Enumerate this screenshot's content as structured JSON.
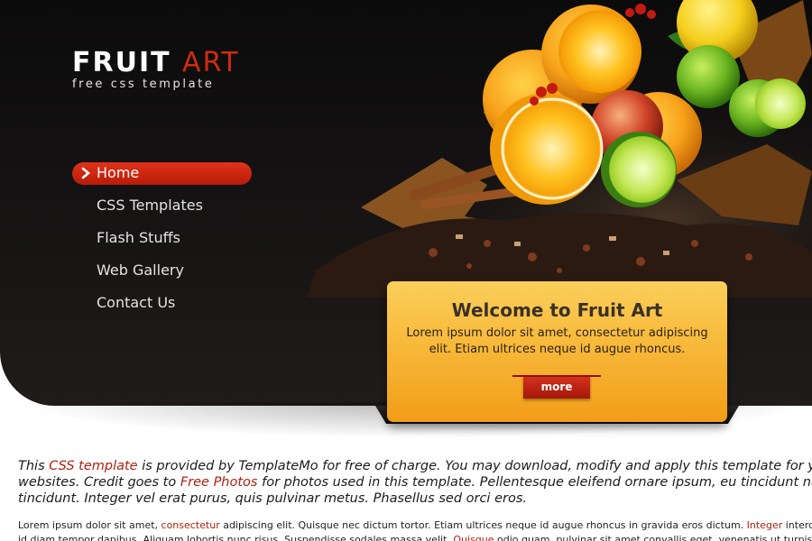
{
  "logo": {
    "title_main": "FRUIT",
    "title_accent": "ART",
    "subtitle": "free css template"
  },
  "nav": {
    "items": [
      {
        "label": "Home",
        "active": true
      },
      {
        "label": "CSS Templates"
      },
      {
        "label": "Flash Stuffs"
      },
      {
        "label": "Web Gallery"
      },
      {
        "label": "Contact Us"
      }
    ]
  },
  "welcome": {
    "title": "Welcome to Fruit Art",
    "text": "Lorem ipsum dolor sit amet, consectetur adipiscing elit. Etiam ultrices neque id augue rhoncus.",
    "button": "more"
  },
  "content": {
    "intro_1": "This ",
    "intro_link_1": "CSS template",
    "intro_2": " is provided by TemplateMo for free of charge. You may download, modify and apply this template for your",
    "intro_3": "websites. Credit goes to ",
    "intro_link_2": "Free Photos",
    "intro_4": " for photos used in this template. Pellentesque eleifend ornare ipsum, eu tincidunt nunc p",
    "intro_5": "tincidunt. Integer vel erat purus, quis pulvinar metus. Phasellus sed orci eros.",
    "body_1": "Lorem ipsum dolor sit amet, ",
    "body_link_1": "consectetur",
    "body_2": " adipiscing elit. Quisque nec dictum tortor. Etiam ultrices neque id augue rhoncus in gravida eros dictum. ",
    "body_link_2": "Integer",
    "body_3": " interd",
    "body_4": "id diam tempor dapibus. Aliquam lobortis nunc risus. Suspendisse sodales massa velit. ",
    "body_link_3": "Quisque",
    "body_5": " odio quam, pulvinar sit amet convallis eget, venenatis ut turpis"
  },
  "colors": {
    "accent": "#d02b10",
    "header_bg": "#141212",
    "welcome_bg": "#f8b93a",
    "link": "#b01f0e"
  }
}
